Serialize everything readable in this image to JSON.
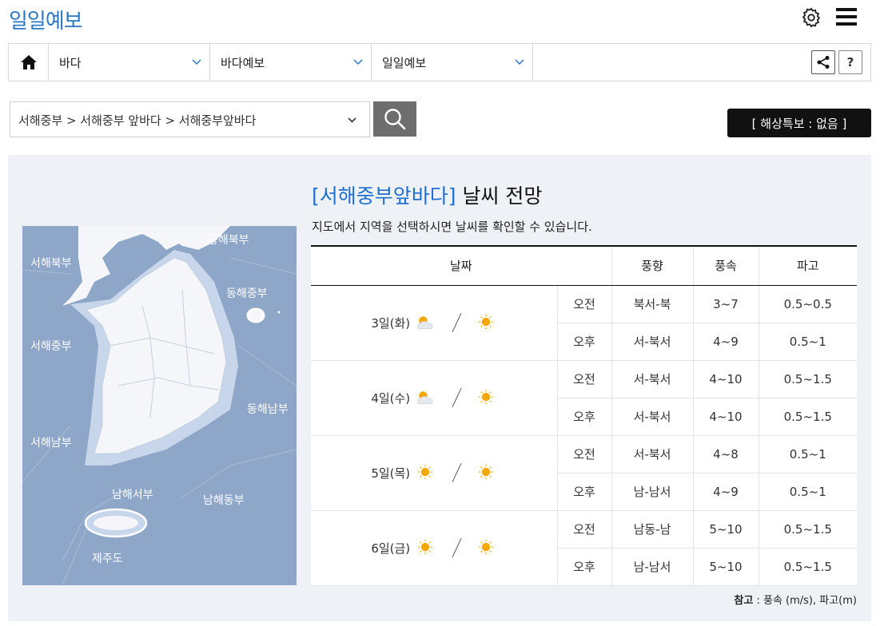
{
  "app": {
    "title": "일일예보"
  },
  "header": {
    "settings_icon": "gear-icon",
    "menu_icon": "hamburger-menu-icon"
  },
  "nav": {
    "home_icon": "home-icon",
    "dropdowns": [
      {
        "label": "바다"
      },
      {
        "label": "바다예보"
      },
      {
        "label": "일일예보"
      }
    ],
    "share_icon": "share-icon",
    "help_label": "?"
  },
  "search": {
    "region_value": "서해중부 > 서해중부 앞바다 > 서해중부앞바다",
    "search_icon": "search-icon"
  },
  "warning": {
    "label": "[ 해상특보 : 없음 ]"
  },
  "forecast": {
    "region": "[서해중부앞바다]",
    "title_rest": " 날씨 전망",
    "guide": "지도에서 지역을 선택하시면 날씨를 확인할 수 있습니다.",
    "columns": {
      "date": "날짜",
      "direction": "풍향",
      "speed": "풍속",
      "wave": "파고"
    },
    "days": [
      {
        "date": "3일(화)",
        "icon_am": "partly-cloudy",
        "icon_pm": "sunny",
        "rows": [
          {
            "period": "오전",
            "direction": "북서-북",
            "speed": "3~7",
            "wave": "0.5~0.5"
          },
          {
            "period": "오후",
            "direction": "서-북서",
            "speed": "4~9",
            "wave": "0.5~1"
          }
        ]
      },
      {
        "date": "4일(수)",
        "icon_am": "partly-cloudy",
        "icon_pm": "sunny",
        "rows": [
          {
            "period": "오전",
            "direction": "서-북서",
            "speed": "4~10",
            "wave": "0.5~1.5"
          },
          {
            "period": "오후",
            "direction": "서-북서",
            "speed": "4~10",
            "wave": "0.5~1.5"
          }
        ]
      },
      {
        "date": "5일(목)",
        "icon_am": "sunny",
        "icon_pm": "sunny",
        "rows": [
          {
            "period": "오전",
            "direction": "서-북서",
            "speed": "4~8",
            "wave": "0.5~1"
          },
          {
            "period": "오후",
            "direction": "남-남서",
            "speed": "4~9",
            "wave": "0.5~1"
          }
        ]
      },
      {
        "date": "6일(금)",
        "icon_am": "sunny",
        "icon_pm": "sunny",
        "rows": [
          {
            "period": "오전",
            "direction": "남동-남",
            "speed": "5~10",
            "wave": "0.5~1.5"
          },
          {
            "period": "오후",
            "direction": "남-남서",
            "speed": "5~10",
            "wave": "0.5~1.5"
          }
        ]
      }
    ],
    "note_label": "참고",
    "note_text": " : 풍속 (m/s), 파고(m)"
  },
  "map": {
    "zones": [
      {
        "id": "west-north",
        "label": "서해북부"
      },
      {
        "id": "east-north",
        "label": "동해북부"
      },
      {
        "id": "east-central",
        "label": "동해중부"
      },
      {
        "id": "west-central",
        "label": "서해중부"
      },
      {
        "id": "east-south",
        "label": "동해남부"
      },
      {
        "id": "west-south",
        "label": "서해남부"
      },
      {
        "id": "south-west",
        "label": "남해서부"
      },
      {
        "id": "south-east",
        "label": "남해동부"
      },
      {
        "id": "jeju",
        "label": "제주도"
      }
    ],
    "colors": {
      "sea": "#8ea6c8",
      "land": "#f4f6f9",
      "coastal": "#c7d6ea"
    }
  }
}
